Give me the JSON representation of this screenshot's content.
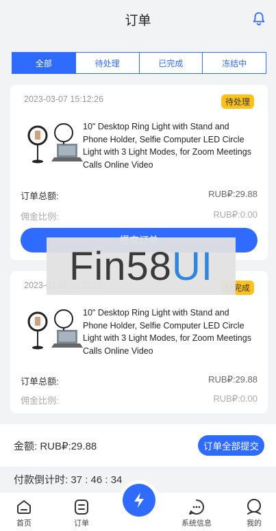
{
  "header": {
    "title": "订单"
  },
  "tabs": [
    {
      "label": "全部",
      "active": true
    },
    {
      "label": "待处理",
      "active": false
    },
    {
      "label": "已完成",
      "active": false
    },
    {
      "label": "冻结中",
      "active": false
    }
  ],
  "orders": [
    {
      "date": "2023-03-07 15:12:26",
      "status": "待处理",
      "product": "10\" Desktop Ring Light with Stand and Phone Holder, Selfie Computer LED Circle Light with 3 Light Modes, for Zoom Meetings Calls Online Video",
      "total_label": "订单总额:",
      "total_value": "RUB₽:29.88",
      "commission_label": "佣金比例:",
      "commission_value": "RUB₽:0.00",
      "submit_label": "提交订单"
    },
    {
      "date": "2023-03-07 15:12:26",
      "status": "已完成",
      "product": "10\" Desktop Ring Light with Stand and Phone Holder, Selfie Computer LED Circle Light with 3 Light Modes, for Zoom Meetings Calls Online Video",
      "total_label": "订单总额:",
      "total_value": "RUB₽:29.88",
      "commission_label": "佣金比例:",
      "commission_value": "RUB₽:0.00"
    }
  ],
  "watermark": {
    "dark": "Fin58",
    "blue": "UI"
  },
  "footer": {
    "amount": "金额:  RUB₽:29.88",
    "submit_all": "订单全部提交",
    "countdown": "付款倒计时:  37 : 46 : 34"
  },
  "tabbar": {
    "home": "首页",
    "orders": "订单",
    "messages": "系统信息",
    "mine": "我的"
  },
  "colors": {
    "accent": "#2f6bff",
    "badge": "#ffc21a",
    "watermark_blue": "#2e86de"
  }
}
